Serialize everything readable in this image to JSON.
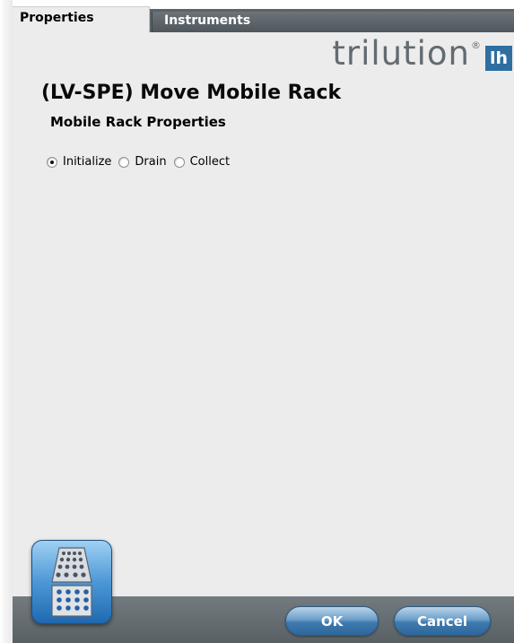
{
  "tabs": {
    "properties": "Properties",
    "instruments": "Instruments"
  },
  "brand": {
    "logo_text": "trilution",
    "badge_text": "lh"
  },
  "title": "(LV-SPE) Move Mobile Rack",
  "subtitle": "Mobile Rack Properties",
  "options": [
    {
      "label": "Initialize",
      "selected": true
    },
    {
      "label": "Drain",
      "selected": false
    },
    {
      "label": "Collect",
      "selected": false
    }
  ],
  "buttons": {
    "ok": "OK",
    "cancel": "Cancel"
  },
  "icons": {
    "rack": "mobile-rack-icon"
  }
}
